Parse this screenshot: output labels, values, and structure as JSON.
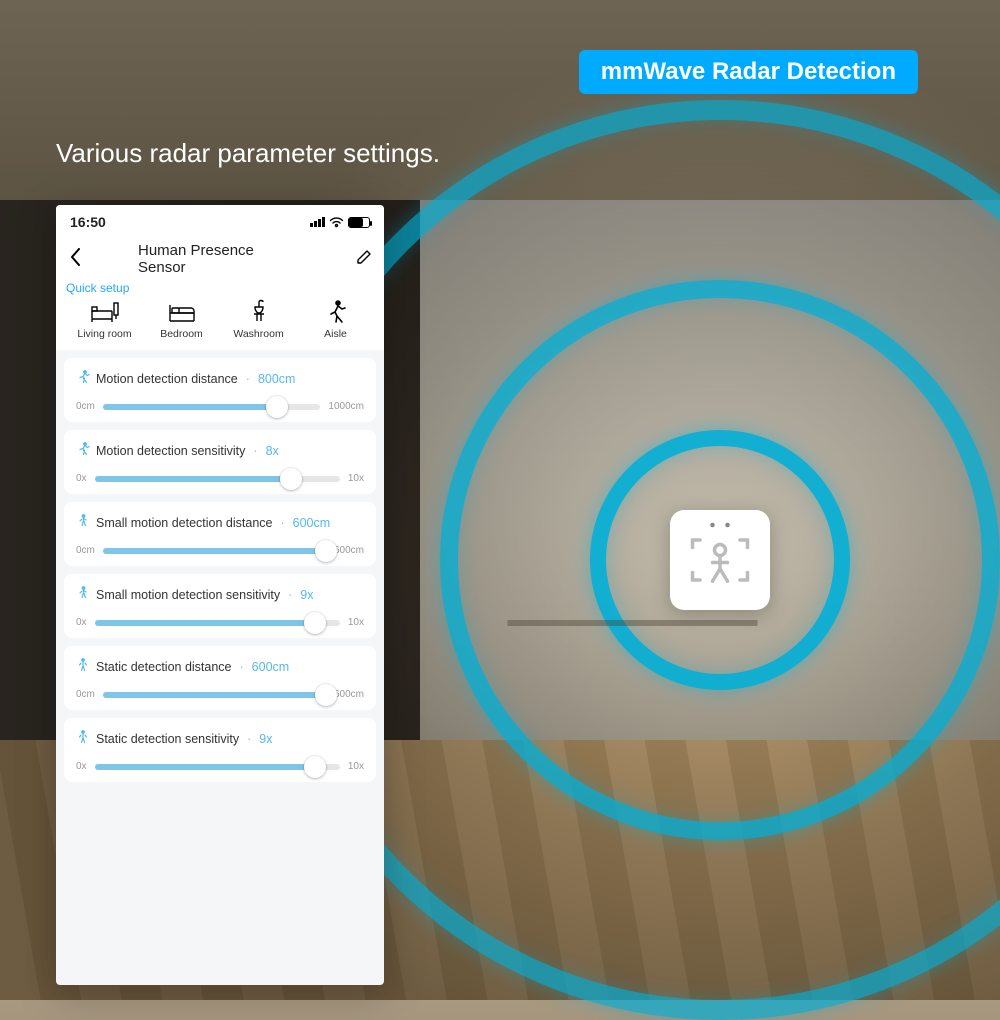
{
  "badge": "mmWave Radar Detection",
  "subtitle": "Various radar parameter settings.",
  "status_bar": {
    "time": "16:50"
  },
  "nav": {
    "title": "Human Presence Sensor"
  },
  "quick_setup": {
    "label": "Quick setup",
    "items": [
      {
        "label": "Living room"
      },
      {
        "label": "Bedroom"
      },
      {
        "label": "Washroom"
      },
      {
        "label": "Aisle"
      }
    ]
  },
  "sliders": [
    {
      "label": "Motion detection distance",
      "value": "800cm",
      "min": "0cm",
      "max": "1000cm",
      "pct": 80,
      "icon": "run"
    },
    {
      "label": "Motion detection sensitivity",
      "value": "8x",
      "min": "0x",
      "max": "10x",
      "pct": 80,
      "icon": "run"
    },
    {
      "label": "Small motion detection distance",
      "value": "600cm",
      "min": "0cm",
      "max": "600cm",
      "pct": 100,
      "icon": "walk"
    },
    {
      "label": "Small motion detection sensitivity",
      "value": "9x",
      "min": "0x",
      "max": "10x",
      "pct": 90,
      "icon": "walk"
    },
    {
      "label": "Static detection distance",
      "value": "600cm",
      "min": "0cm",
      "max": "600cm",
      "pct": 100,
      "icon": "stand"
    },
    {
      "label": "Static detection sensitivity",
      "value": "9x",
      "min": "0x",
      "max": "10x",
      "pct": 90,
      "icon": "stand"
    }
  ]
}
